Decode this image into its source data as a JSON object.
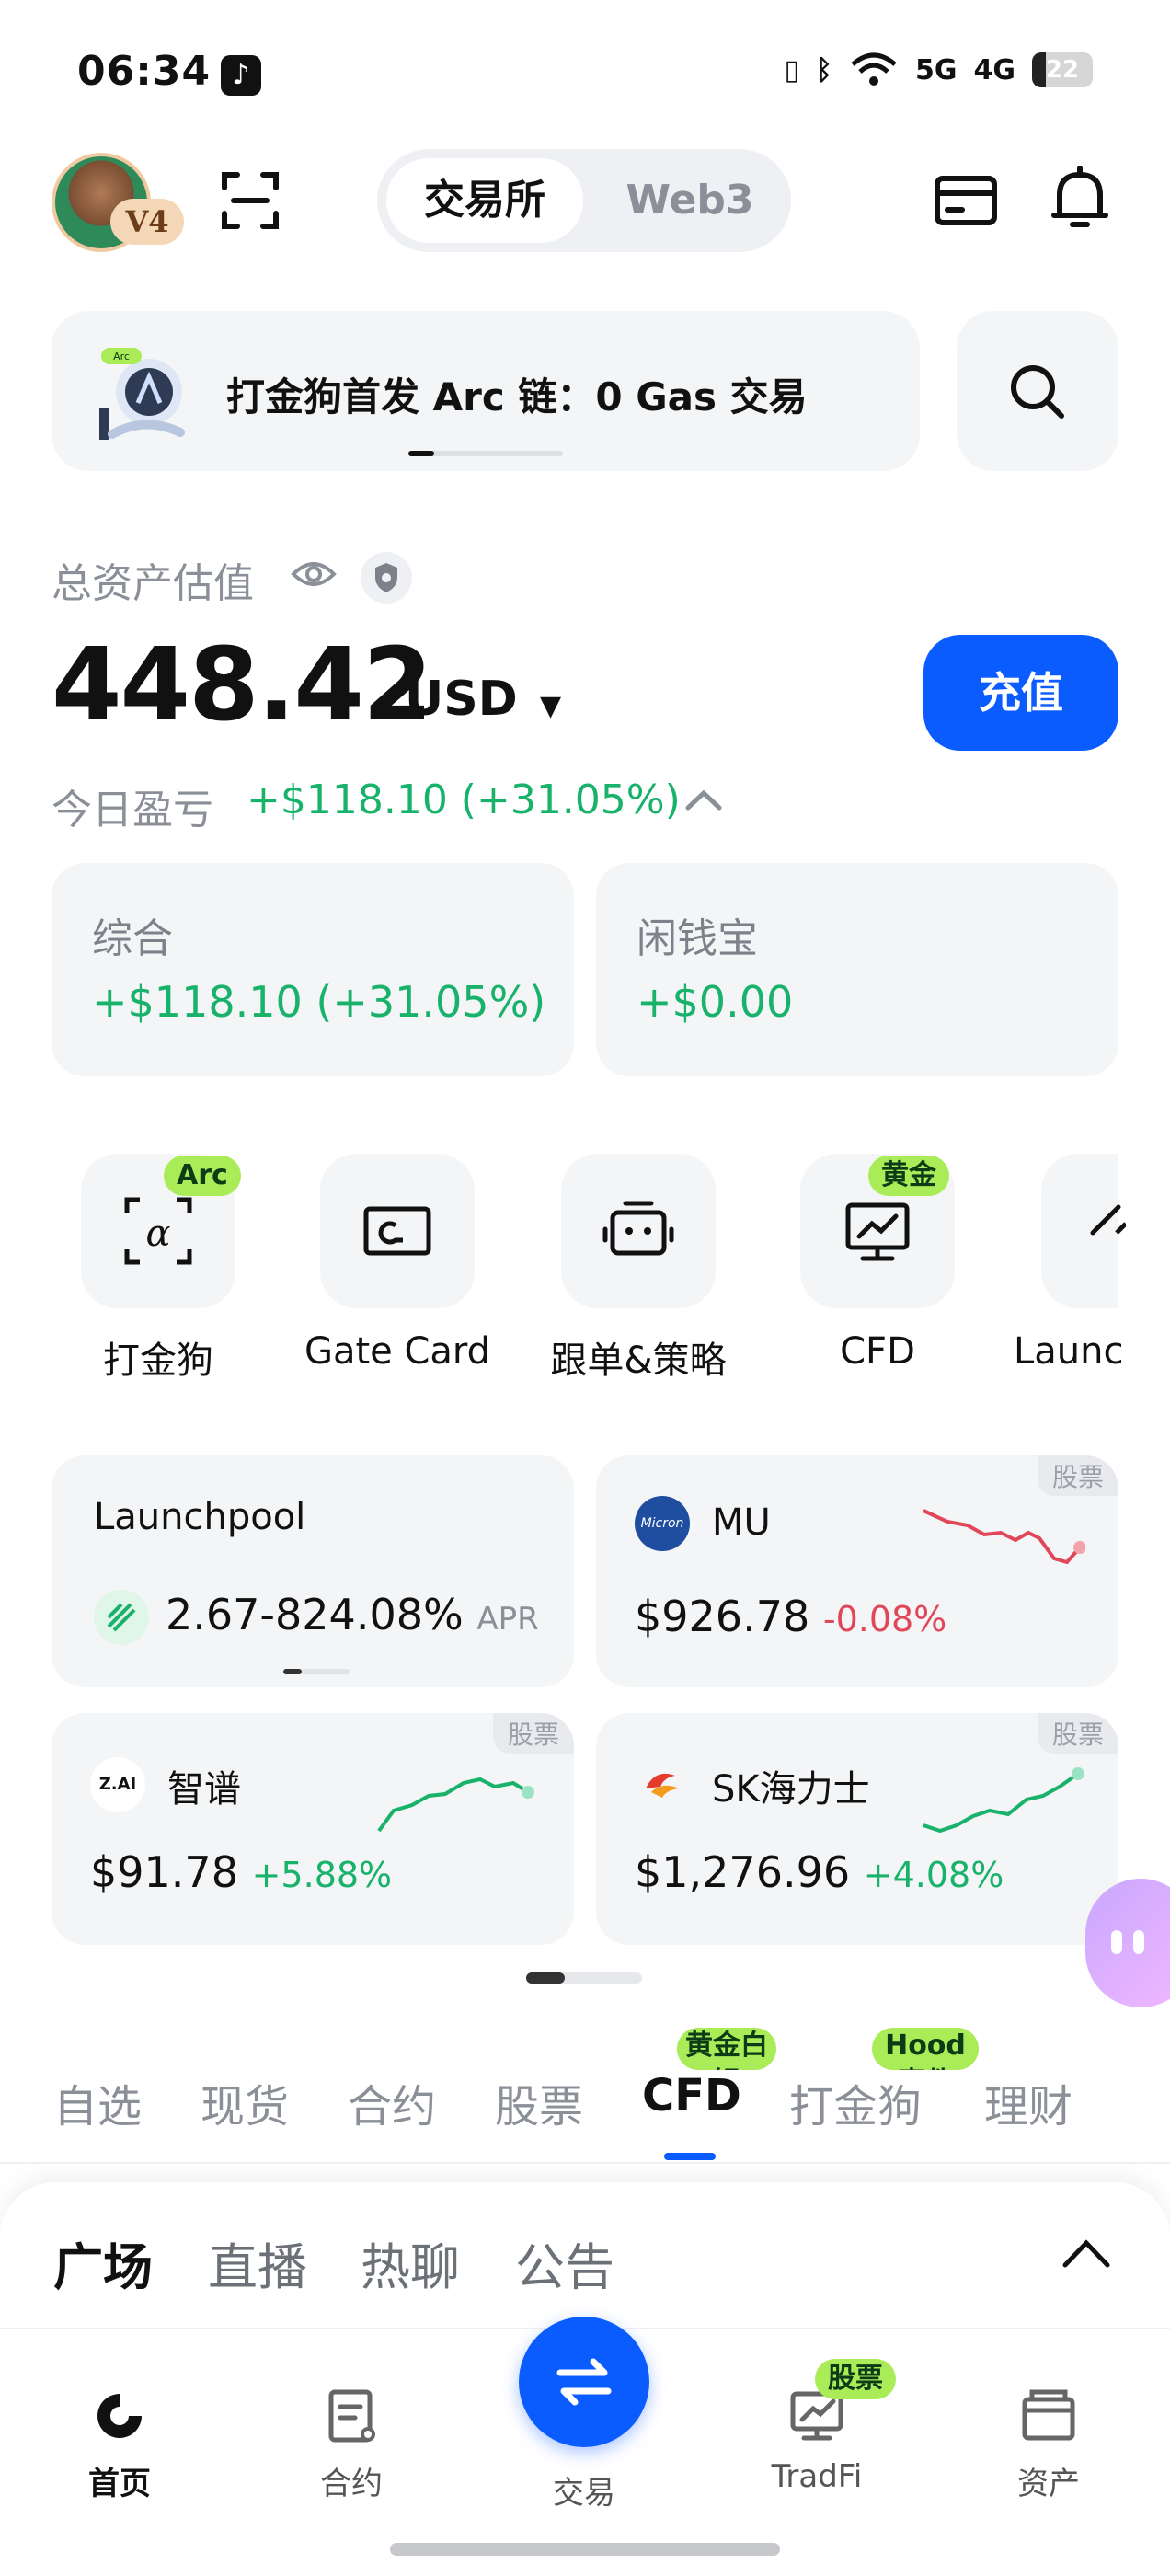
{
  "status_bar": {
    "time": "06:34",
    "network_1": "5G",
    "network_2": "4G",
    "battery": "22",
    "battery_level": 0.22
  },
  "header": {
    "level_badge": "V4",
    "segments": [
      "交易所",
      "Web3"
    ],
    "active_segment": "交易所"
  },
  "banner": {
    "text": "打金狗首发 Arc 链：0 Gas 交易",
    "art_tag": "Arc"
  },
  "assets": {
    "label": "总资产估值",
    "balance": "448.42",
    "currency": "USD",
    "deposit_label": "充值",
    "pnl_label": "今日盈亏",
    "pnl_value": "+$118.10 (+31.05%)"
  },
  "stat_cards": [
    {
      "title": "综合",
      "value": "+$118.10 (+31.05%)"
    },
    {
      "title": "闲钱宝",
      "value": "+$0.00"
    }
  ],
  "quick_actions": [
    {
      "label": "打金狗",
      "tag": "Arc",
      "icon": "dajingou-icon"
    },
    {
      "label": "Gate Card",
      "tag": "",
      "icon": "gate-card-icon"
    },
    {
      "label": "跟单&策略",
      "tag": "",
      "icon": "copy-trade-icon"
    },
    {
      "label": "CFD",
      "tag": "黄金",
      "icon": "cfd-chart-icon"
    },
    {
      "label": "Launc",
      "tag": "",
      "icon": "launch-icon"
    }
  ],
  "market_cards": {
    "launchpool": {
      "title": "Launchpool",
      "apr": "2.67-824.08%",
      "apr_label": "APR"
    },
    "mu": {
      "tag": "股票",
      "logo": "Micron",
      "name": "MU",
      "price": "$926.78",
      "change": "-0.08%",
      "color": "#e0485a"
    },
    "zhipu": {
      "tag": "股票",
      "logo": "Z.AI",
      "name": "智谱",
      "price": "$91.78",
      "change": "+5.88%",
      "color": "#18b26b"
    },
    "skhynix": {
      "tag": "股票",
      "name": "SK海力士",
      "price": "$1,276.96",
      "change": "+4.08%",
      "color": "#18b26b"
    }
  },
  "category_tabs": [
    {
      "label": "自选",
      "tag": ""
    },
    {
      "label": "现货",
      "tag": ""
    },
    {
      "label": "合约",
      "tag": ""
    },
    {
      "label": "股票",
      "tag": ""
    },
    {
      "label": "CFD",
      "tag": "黄金白银",
      "active": true
    },
    {
      "label": "打金狗",
      "tag": "Hood事件"
    },
    {
      "label": "理财",
      "tag": ""
    }
  ],
  "feed_tabs": [
    "广场",
    "直播",
    "热聊",
    "公告"
  ],
  "bottom_nav": [
    {
      "label": "首页",
      "icon": "home-icon",
      "active": true
    },
    {
      "label": "合约",
      "icon": "contract-icon"
    },
    {
      "label": "交易",
      "icon": "swap-arrows-icon"
    },
    {
      "label": "TradFi",
      "icon": "tradfi-icon",
      "tag": "股票"
    },
    {
      "label": "资产",
      "icon": "wallet-icon"
    }
  ],
  "colors": {
    "accent": "#0b5cff",
    "gain": "#18b26b",
    "loss": "#e0485a",
    "tag_green": "#a9ec58"
  }
}
